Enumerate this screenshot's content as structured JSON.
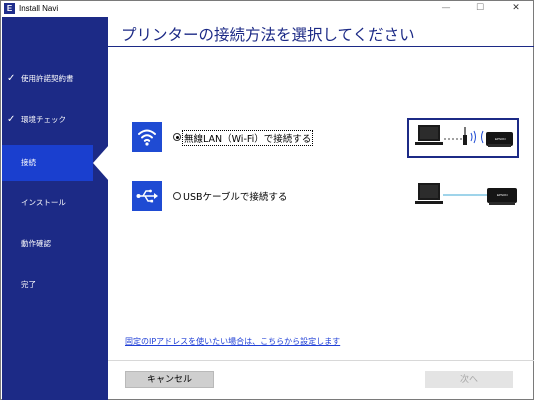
{
  "window": {
    "app_icon_letter": "E",
    "title": "Install Navi",
    "minimize": "—",
    "maximize": "☐",
    "close": "✕"
  },
  "sidebar": {
    "items": [
      {
        "label": "使用許諾契約書",
        "done": true,
        "check": "✓"
      },
      {
        "label": "環境チェック",
        "done": true,
        "check": "✓"
      },
      {
        "label": "接続",
        "done": false,
        "active": true
      },
      {
        "label": "インストール",
        "done": false
      },
      {
        "label": "動作確認",
        "done": false
      },
      {
        "label": "完了",
        "done": false
      }
    ],
    "bg_color": "#1c2a86",
    "active_color": "#1a3fcf"
  },
  "main": {
    "title": "プリンターの接続方法を選択してください",
    "options": [
      {
        "label": "無線LAN（Wi-Fi）で接続する",
        "selected": true,
        "icon": "wifi-icon"
      },
      {
        "label": "USBケーブルで接続する",
        "selected": false,
        "icon": "usb-icon"
      }
    ],
    "printer_brand": "EPSON",
    "link_text": "固定のIPアドレスを使いたい場合は、こちらから設定します"
  },
  "footer": {
    "cancel_label": "キャンセル",
    "next_label": "次へ",
    "next_enabled": false
  },
  "colors": {
    "accent": "#1c2a86",
    "icon_box": "#1f4bd3",
    "link": "#1f3fd6"
  }
}
